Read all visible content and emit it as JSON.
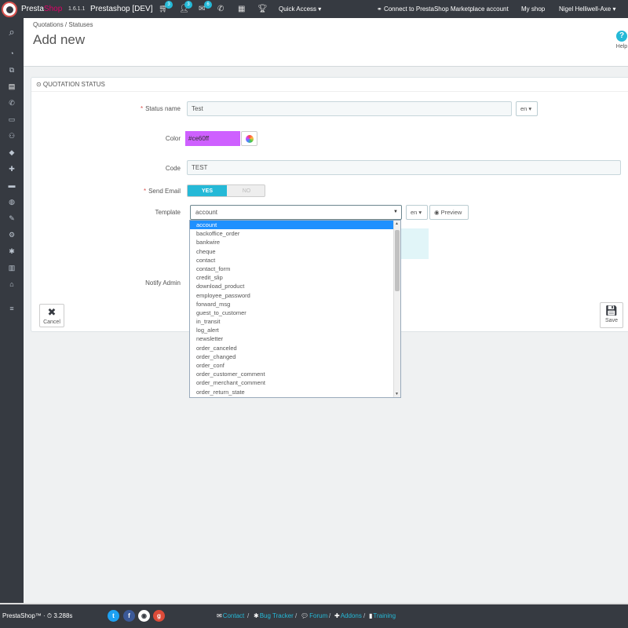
{
  "topbar": {
    "brand_presta": "Presta",
    "brand_shop": "Shop",
    "version": "1.6.1.1",
    "shop_name": "Prestashop [DEV]",
    "badge_orders": "3",
    "badge_customers": "3",
    "badge_messages": "6",
    "quick_access": "Quick Access ▾",
    "connect": "Connect to PrestaShop Marketplace account",
    "my_shop": "My shop",
    "user": "Nigel Helliwell-Axe ▾"
  },
  "breadcrumb": "Quotations  /  Statuses",
  "page_title": "Add new",
  "help_label": "Help",
  "panel": {
    "heading": "⊙ QUOTATION STATUS"
  },
  "form": {
    "status_name_label": "Status name",
    "status_name_value": "Test",
    "status_lang": "en ▾",
    "color_label": "Color",
    "color_value": "#ce60ff",
    "code_label": "Code",
    "code_value": "TEST",
    "send_email_label": "Send Email",
    "yes_label": "YES",
    "no_label": "NO",
    "template_label": "Template",
    "template_value": "account",
    "template_lang": "en ▾",
    "preview_label": "◉ Preview",
    "notify_admin_label": "Notify Admin"
  },
  "buttons": {
    "cancel": "Cancel",
    "save": "Save"
  },
  "dropdown_options": [
    "account",
    "backoffice_order",
    "bankwire",
    "cheque",
    "contact",
    "contact_form",
    "credit_slip",
    "download_product",
    "employee_password",
    "forward_msg",
    "guest_to_customer",
    "in_transit",
    "log_alert",
    "newsletter",
    "order_canceled",
    "order_changed",
    "order_conf",
    "order_customer_comment",
    "order_merchant_comment",
    "order_return_state"
  ],
  "footer": {
    "version": "PrestaShop™ · ⏱ 3.288s",
    "contact": "Contact",
    "bug_tracker": "Bug Tracker",
    "forum": "Forum",
    "addons": "Addons",
    "training": "Training"
  },
  "colors": {
    "accent": "#25b9d7",
    "dark_bar": "#363a41",
    "picked_color": "#ce60ff",
    "brand_pink": "#df0067"
  }
}
